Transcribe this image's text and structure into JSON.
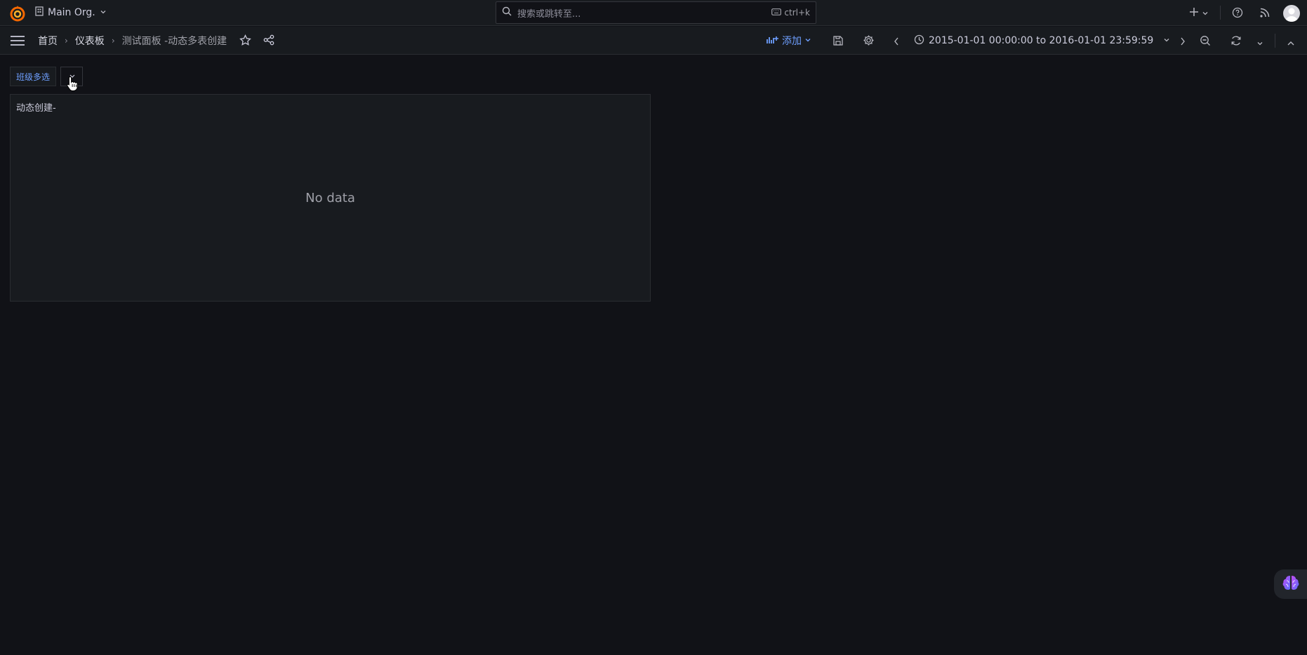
{
  "topbar": {
    "org_name": "Main Org.",
    "search_placeholder": "搜索或跳转至...",
    "search_shortcut": "ctrl+k",
    "icons": [
      "grafana-logo-icon",
      "building-icon",
      "chevron-down-icon",
      "search-icon",
      "keyboard-icon",
      "plus-icon",
      "help-icon",
      "rss-icon",
      "avatar"
    ]
  },
  "navbar": {
    "breadcrumbs": [
      "首页",
      "仪表板",
      "测试面板 -动态多表创建"
    ],
    "add_label": "添加",
    "time_range": "2015-01-01 00:00:00 to 2016-01-01 23:59:59",
    "icons": [
      "menu-icon",
      "star-icon",
      "share-icon",
      "add-panel-icon",
      "save-icon",
      "gear-icon",
      "chevron-left-icon",
      "clock-icon",
      "chevron-right-icon",
      "zoom-out-icon",
      "refresh-icon",
      "chevron-up-icon"
    ]
  },
  "variables": {
    "label": "班级多选"
  },
  "panel": {
    "title": "动态创建-",
    "message": "No data"
  },
  "colors": {
    "background": "#111217",
    "surface": "#181b1f",
    "accent": "#6e9fff",
    "logo": "#f46800"
  }
}
